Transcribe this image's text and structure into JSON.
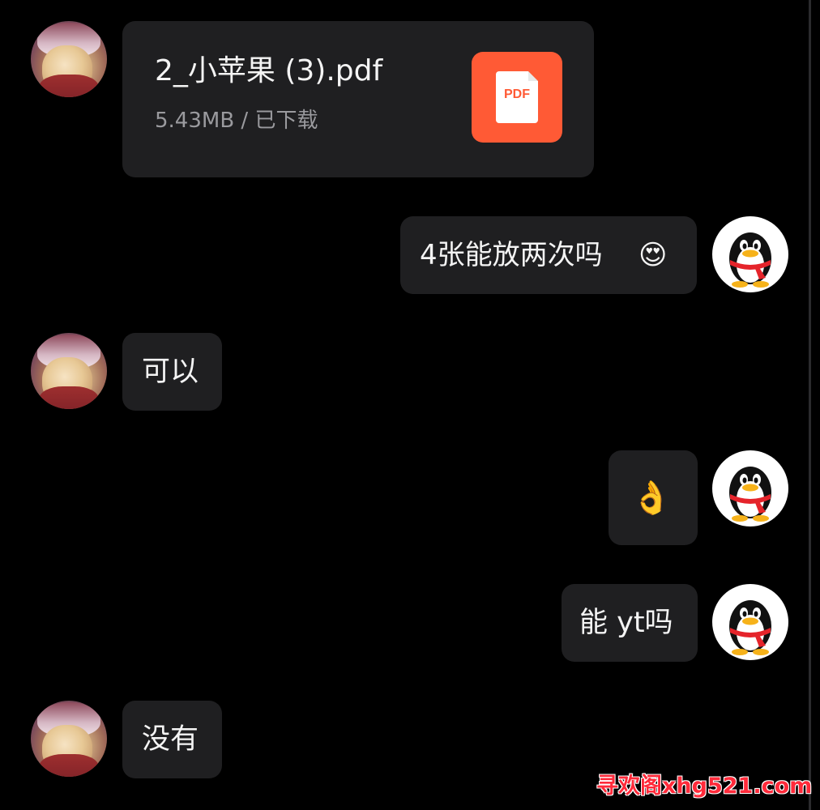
{
  "conversation": {
    "messages": [
      {
        "sender": "other",
        "type": "file",
        "file_name": "2_小苹果 (3).pdf",
        "file_meta": "5.43MB / 已下载",
        "file_icon": "pdf-icon",
        "file_icon_label": "PDF",
        "file_icon_color": "#ff5a35"
      },
      {
        "sender": "self",
        "type": "text",
        "text": "4张能放两次吗",
        "emoji": "😍"
      },
      {
        "sender": "other",
        "type": "text",
        "text": "可以"
      },
      {
        "sender": "self",
        "type": "emoji",
        "emoji": "👌"
      },
      {
        "sender": "self",
        "type": "text",
        "text": "能 yt吗"
      },
      {
        "sender": "other",
        "type": "text",
        "text": "没有"
      }
    ]
  },
  "avatars": {
    "other": "girl-photo-avatar",
    "self": "qq-penguin-avatar"
  },
  "watermark": "寻欢阁xhg521.com",
  "colors": {
    "background": "#000000",
    "bubble": "#1f1f21",
    "text": "#f4f4f4",
    "meta_text": "#9a9a9e",
    "watermark": "#ff2a3a"
  }
}
